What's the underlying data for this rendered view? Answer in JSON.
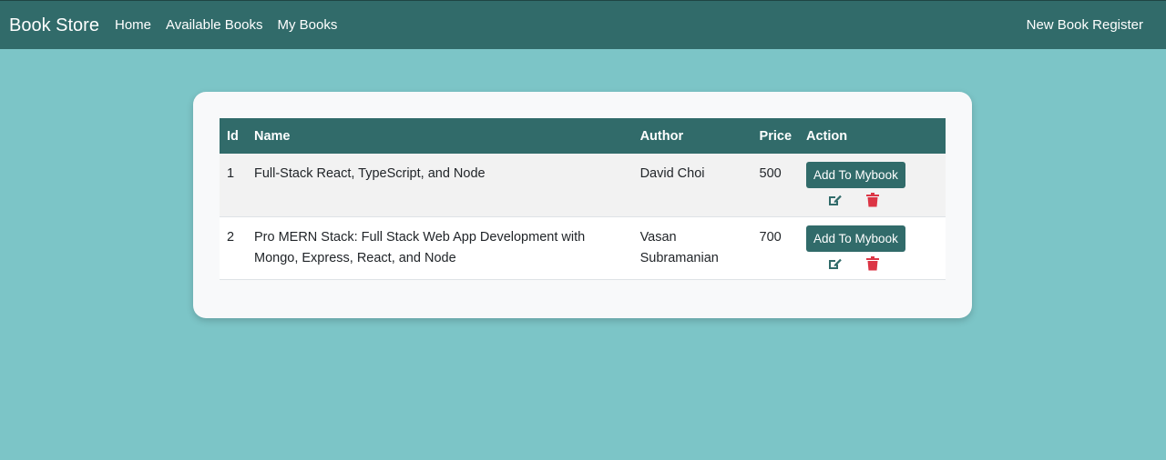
{
  "navbar": {
    "brand": "Book Store",
    "links": [
      {
        "label": "Home"
      },
      {
        "label": "Available Books"
      },
      {
        "label": "My Books"
      }
    ],
    "right_link": "New Book Register"
  },
  "table": {
    "headers": [
      "Id",
      "Name",
      "Author",
      "Price",
      "Action"
    ],
    "rows": [
      {
        "id": "1",
        "name": "Full-Stack React, TypeScript, and Node",
        "author": "David Choi",
        "price": "500",
        "action_label": "Add To Mybook",
        "icons": [
          "edit-icon",
          "trash-icon"
        ]
      },
      {
        "id": "2",
        "name": "Pro MERN Stack: Full Stack Web App Development with Mongo, Express, React, and Node",
        "author": "Vasan Subramanian",
        "price": "700",
        "action_label": "Add To Mybook",
        "icons": [
          "edit-icon",
          "trash-icon"
        ]
      }
    ]
  },
  "colors": {
    "background": "#7cc5c7",
    "primary": "#316b6a",
    "card": "#f8f9fa",
    "danger": "#dc3545"
  }
}
